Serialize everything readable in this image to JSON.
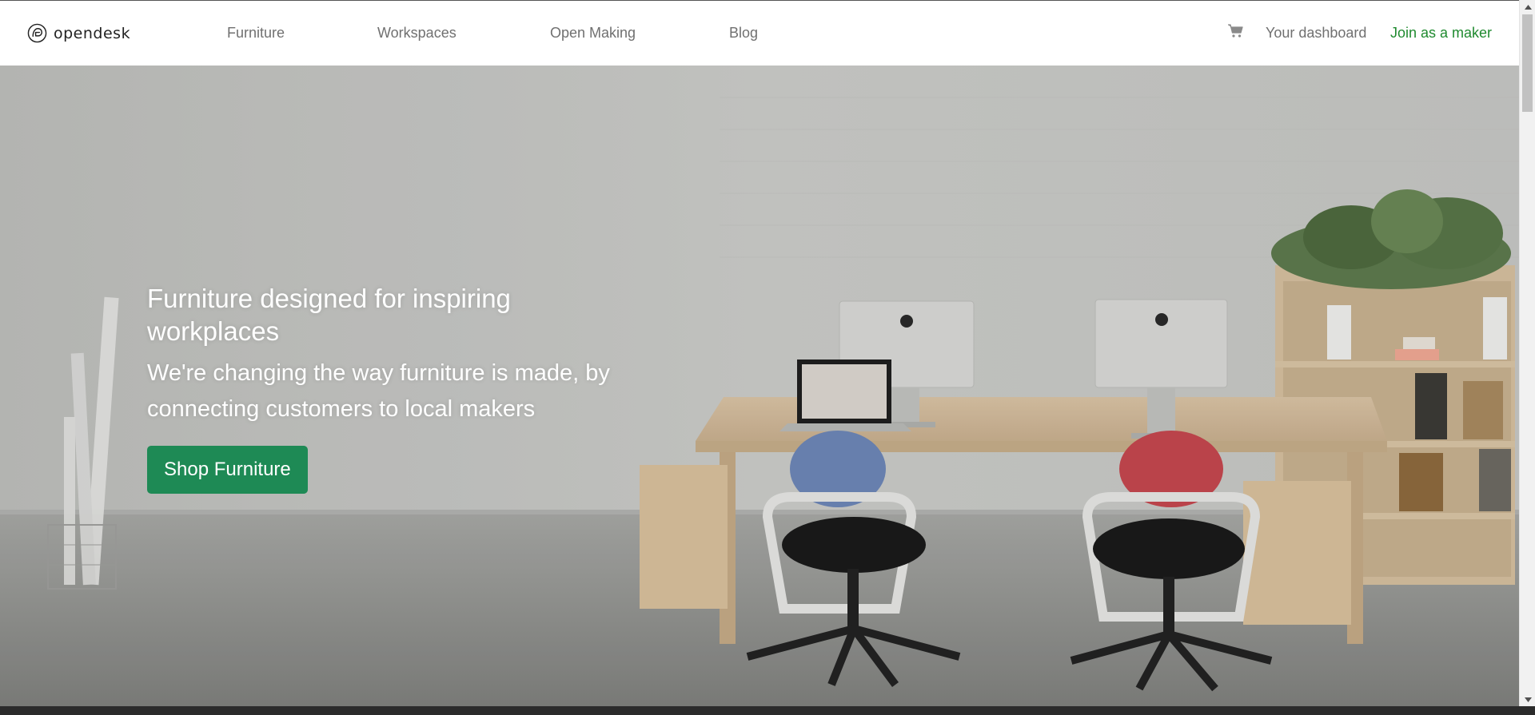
{
  "brand": {
    "name": "opendesk",
    "icon": "opendesk-logo-icon"
  },
  "nav": {
    "items": [
      {
        "label": "Furniture"
      },
      {
        "label": "Workspaces"
      },
      {
        "label": "Open Making"
      },
      {
        "label": "Blog"
      }
    ]
  },
  "account": {
    "cart_icon": "shopping-cart-icon",
    "dashboard_label": "Your dashboard",
    "join_label": "Join as a maker"
  },
  "hero": {
    "title": "Furniture designed for inspiring workplaces",
    "subtitle": "We're changing the way furniture is made, by connecting customers to local makers",
    "cta_label": "Shop Furniture"
  },
  "colors": {
    "accent_green": "#1e8a55",
    "join_link_green": "#1f8a2f",
    "nav_text": "#707070"
  }
}
